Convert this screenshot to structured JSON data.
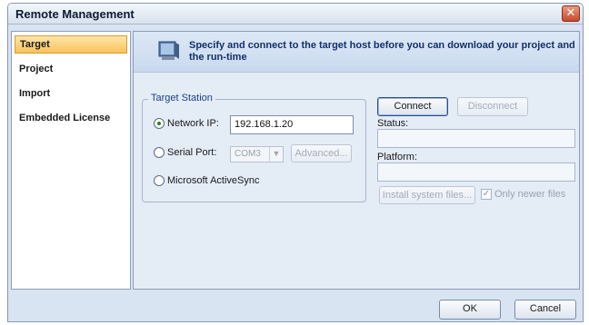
{
  "window": {
    "title": "Remote Management",
    "close_glyph": "✕"
  },
  "sidebar": {
    "items": [
      {
        "label": "Target",
        "active": true
      },
      {
        "label": "Project",
        "active": false
      },
      {
        "label": "Import",
        "active": false
      },
      {
        "label": "Embedded License",
        "active": false
      }
    ]
  },
  "header": {
    "icon": "monitor-icon",
    "text": "Specify and connect to the target host before you can download your project and the run-time"
  },
  "target_station": {
    "legend": "Target Station",
    "network_ip": {
      "label": "Network IP:",
      "value": "192.168.1.20",
      "selected": true
    },
    "serial_port": {
      "label": "Serial Port:",
      "port": "COM3",
      "advanced_label": "Advanced...",
      "selected": false
    },
    "activesync": {
      "label": "Microsoft ActiveSync",
      "selected": false
    }
  },
  "connection": {
    "connect_label": "Connect",
    "disconnect_label": "Disconnect",
    "status_label": "Status:",
    "status_value": "",
    "platform_label": "Platform:",
    "platform_value": "",
    "install_label": "Install system files...",
    "only_newer_label": "Only newer files",
    "only_newer_checked": true
  },
  "footer": {
    "ok_label": "OK",
    "cancel_label": "Cancel"
  },
  "colors": {
    "active_item": "#f9c25c",
    "title_text": "#0d1a33",
    "header_text": "#13306b",
    "close_button": "#c64a2c"
  }
}
